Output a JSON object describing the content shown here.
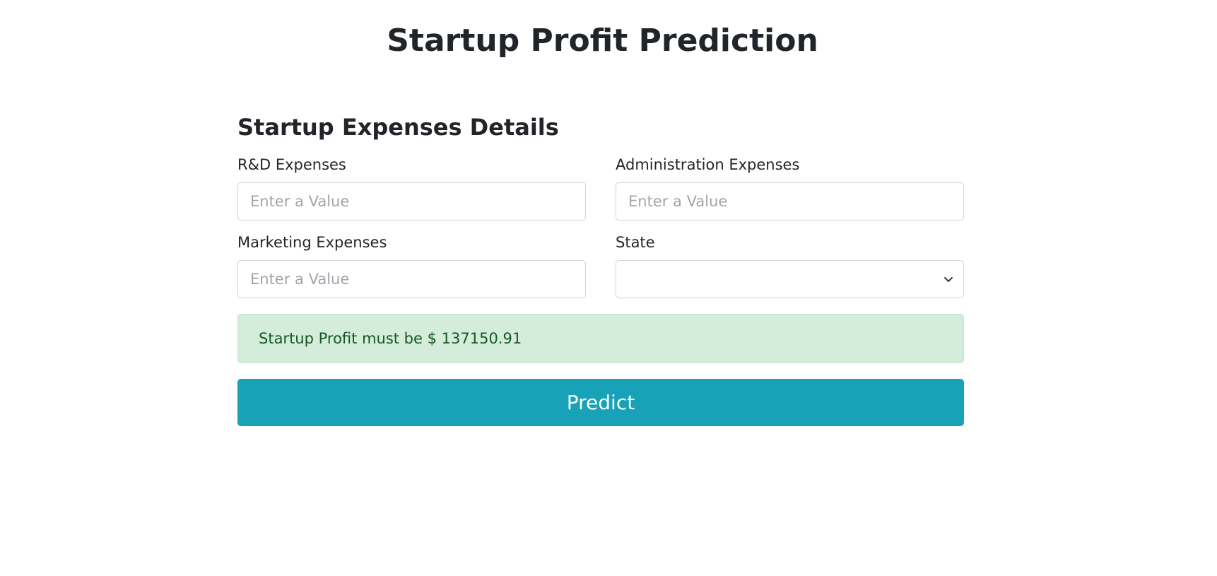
{
  "page": {
    "title": "Startup Profit Prediction"
  },
  "form": {
    "section_title": "Startup Expenses Details",
    "fields": {
      "rd": {
        "label": "R&D Expenses",
        "placeholder": "Enter a Value",
        "value": ""
      },
      "admin": {
        "label": "Administration Expenses",
        "placeholder": "Enter a Value",
        "value": ""
      },
      "marketing": {
        "label": "Marketing Expenses",
        "placeholder": "Enter a Value",
        "value": ""
      },
      "state": {
        "label": "State",
        "selected": ""
      }
    },
    "result_text": "Startup Profit must be $ 137150.91",
    "predict_label": "Predict"
  },
  "colors": {
    "primary": "#17a2b8",
    "success_bg": "#d4edda",
    "success_text": "#155724",
    "text": "#212529",
    "border": "#ced4da"
  },
  "icons": {
    "state_dropdown": "chevron-down-icon"
  }
}
